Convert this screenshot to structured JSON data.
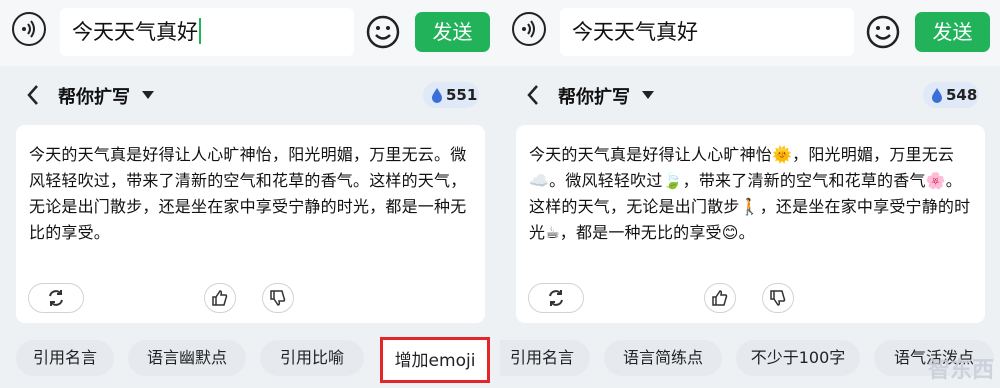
{
  "left": {
    "input_text": "今天天气真好",
    "send_label": "发送",
    "title": "帮你扩写",
    "credit": "551",
    "result_text": "今天的天气真是好得让人心旷神怡，阳光明媚，万里无云。微风轻轻吹过，带来了清新的空气和花草的香气。这样的天气，无论是出门散步，还是坐在家中享受宁静的时光，都是一种无比的享受。",
    "chips": [
      "引用名言",
      "语言幽默点",
      "引用比喻",
      "增加emoji"
    ]
  },
  "right": {
    "input_text": "今天天气真好",
    "send_label": "发送",
    "title": "帮你扩写",
    "credit": "548",
    "result_text": "今天的天气真是好得让人心旷神怡🌞，阳光明媚，万里无云☁️。微风轻轻吹过🍃，带来了清新的空气和花草的香气🌸。这样的天气，无论是出门散步🚶，还是坐在家中享受宁静的时光☕，都是一种无比的享受😊。",
    "chips": [
      "引用名言",
      "语言简练点",
      "不少于100字",
      "语气活泼点"
    ]
  },
  "watermark": "智东西",
  "colors": {
    "send": "#22b35a",
    "highlight": "#e5252a",
    "credit_bg": "#dfe9f7",
    "drop": "#3b6fd8"
  },
  "icons": [
    "voice-icon",
    "smiley-icon",
    "back-chevron-icon",
    "dropdown-caret-icon",
    "drop-icon",
    "refresh-icon",
    "thumbs-up-icon",
    "thumbs-down-icon"
  ]
}
